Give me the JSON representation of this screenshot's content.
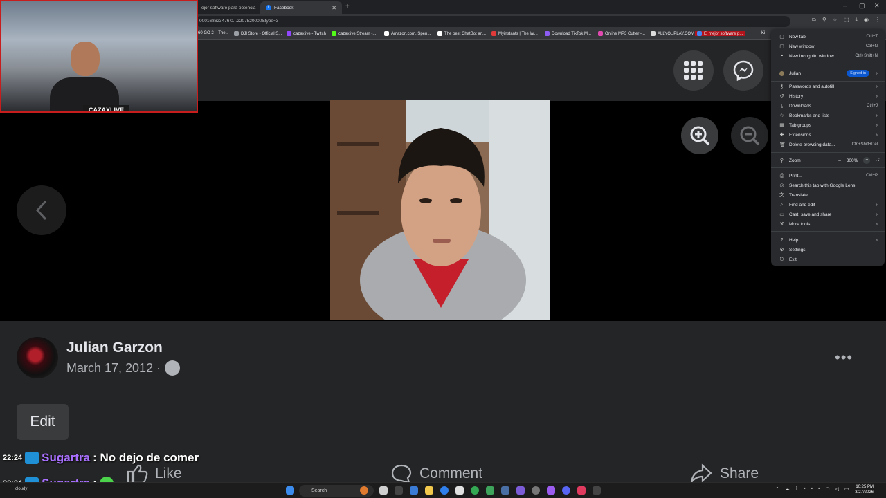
{
  "browser": {
    "tabs": [
      {
        "label": "ejor software para potencia",
        "active": false
      },
      {
        "label": "Facebook",
        "active": true
      }
    ],
    "new_tab_symbol": "+",
    "window_controls": [
      "–",
      "▢",
      "✕"
    ],
    "url": "000168623476 0...2207520000&type=3",
    "bookmarks": [
      {
        "label": "60 GO 2 – The...",
        "color": "#8ab4f8"
      },
      {
        "label": "DJI Store - Official S...",
        "color": "#9aa0a6"
      },
      {
        "label": "cazaxlive - Twitch",
        "color": "#9146ff"
      },
      {
        "label": "cazaxlive Stream -...",
        "color": "#53fc18"
      },
      {
        "label": "Amazon.com. Spen...",
        "color": "#ffffff"
      },
      {
        "label": "The best ChatBot an...",
        "color": "#ffffff"
      },
      {
        "label": "Myinstants | The lar...",
        "color": "#e03a3a"
      },
      {
        "label": "Download TikTok M...",
        "color": "#8c5cf5"
      },
      {
        "label": "Online MP3 Cutter -...",
        "color": "#e04ab0"
      },
      {
        "label": "ALLYOUPLAY.COM -...",
        "color": "#dddddd"
      },
      {
        "label": "El mejor software p...",
        "color": "#4285f4"
      }
    ],
    "bookmark_overflow": "Ki"
  },
  "webcam": {
    "label": "CAZAXLIVE"
  },
  "photo_viewer": {
    "author": "Julian Garzon",
    "date": "March 17, 2012 ·",
    "edit_label": "Edit",
    "like_label": "Like",
    "comment_label": "Comment",
    "share_label": "Share",
    "more_label": "•••"
  },
  "chat": [
    {
      "time": "22:24",
      "user": "Sugartra",
      "message": ": No dejo de comer"
    },
    {
      "time": "22:24",
      "user": "Sugartra",
      "message": ":"
    }
  ],
  "menu": {
    "items": [
      {
        "label": "New tab",
        "shortcut": "Ctrl+T",
        "icon": "new-tab-icon"
      },
      {
        "label": "New window",
        "shortcut": "Ctrl+N",
        "icon": "new-window-icon"
      },
      {
        "label": "New Incognito window",
        "shortcut": "Ctrl+Shift+N",
        "icon": "incognito-icon"
      }
    ],
    "profile": {
      "label": "Julian",
      "badge": "Signed in"
    },
    "items2": [
      {
        "label": "Passwords and autofill",
        "shortcut": "",
        "icon": "key-icon"
      },
      {
        "label": "History",
        "shortcut": "",
        "icon": "history-icon"
      },
      {
        "label": "Downloads",
        "shortcut": "Ctrl+J",
        "icon": "download-icon"
      },
      {
        "label": "Bookmarks and lists",
        "shortcut": "",
        "icon": "star-icon"
      },
      {
        "label": "Tab groups",
        "shortcut": "",
        "icon": "tab-groups-icon"
      },
      {
        "label": "Extensions",
        "shortcut": "",
        "icon": "puzzle-icon"
      },
      {
        "label": "Delete browsing data...",
        "shortcut": "Ctrl+Shift+Del",
        "icon": "trash-icon"
      }
    ],
    "zoom": {
      "label": "Zoom",
      "minus": "–",
      "value": "300%",
      "plus": "+"
    },
    "items3": [
      {
        "label": "Print...",
        "shortcut": "Ctrl+P",
        "icon": "print-icon"
      },
      {
        "label": "Search this tab with Google Lens",
        "shortcut": "",
        "icon": "lens-icon"
      },
      {
        "label": "Translate...",
        "shortcut": "",
        "icon": "translate-icon"
      },
      {
        "label": "Find and edit",
        "shortcut": "",
        "icon": "find-icon"
      },
      {
        "label": "Cast, save and share",
        "shortcut": "",
        "icon": "cast-icon"
      },
      {
        "label": "More tools",
        "shortcut": "",
        "icon": "tools-icon"
      }
    ],
    "items4": [
      {
        "label": "Help",
        "shortcut": "",
        "icon": "help-icon"
      },
      {
        "label": "Settings",
        "shortcut": "",
        "icon": "gear-icon"
      },
      {
        "label": "Exit",
        "shortcut": "",
        "icon": "exit-icon"
      }
    ]
  },
  "taskbar": {
    "search_label": "Search",
    "weather": "cloudy",
    "time": "10:25 PM",
    "date": "3/27/2026"
  }
}
